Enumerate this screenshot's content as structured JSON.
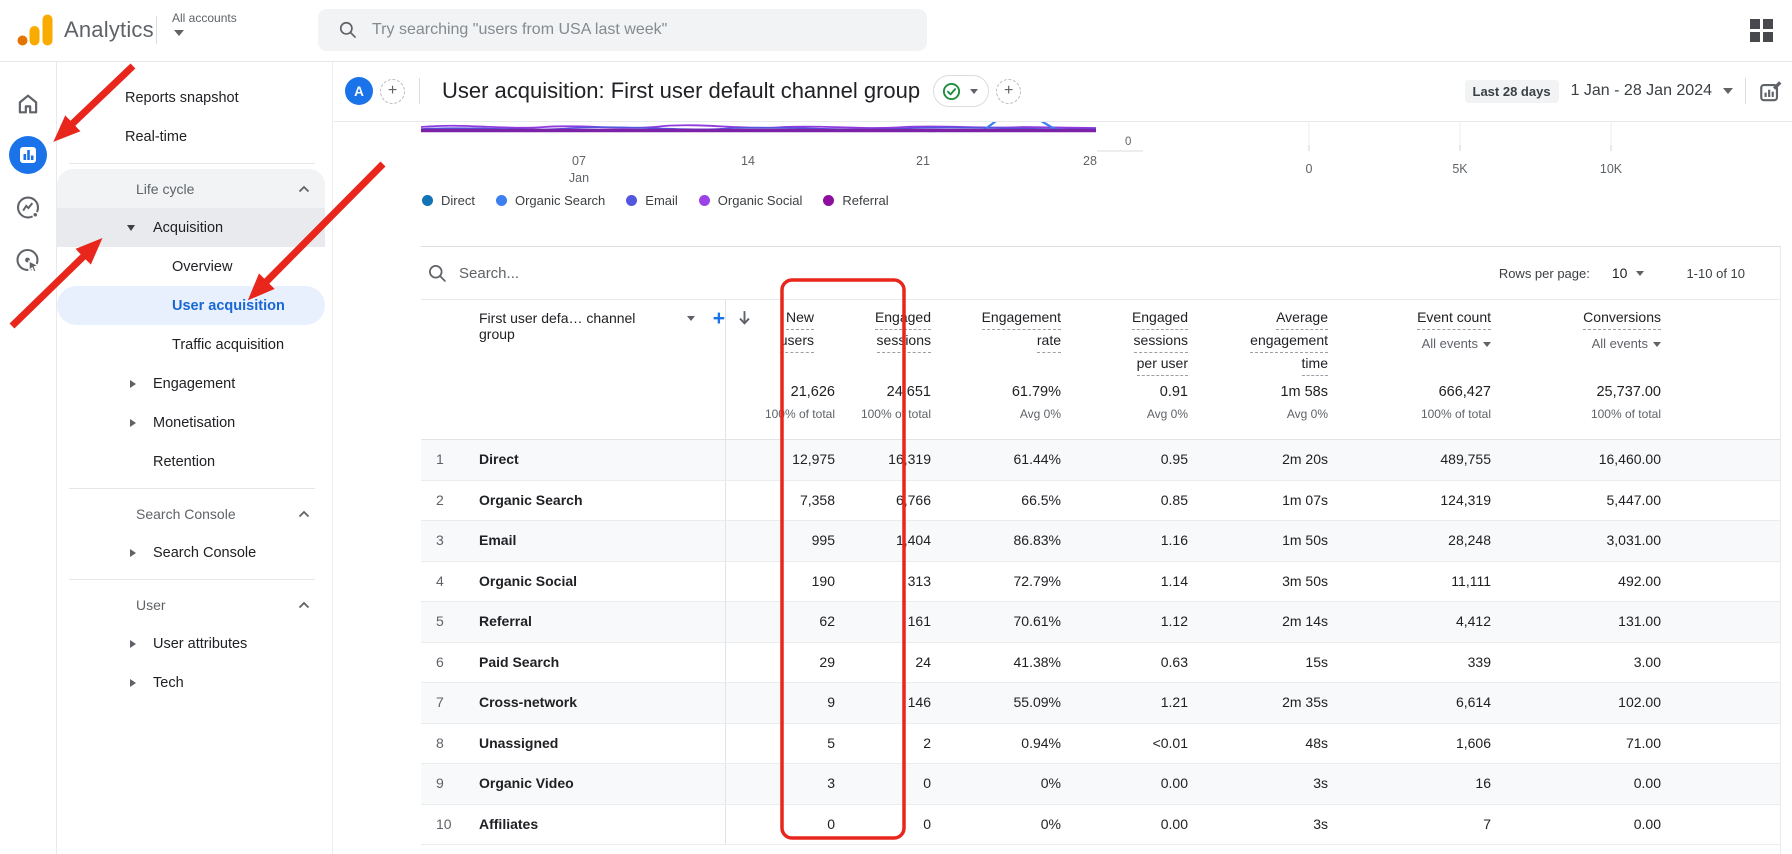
{
  "app": {
    "product_name": "Analytics",
    "account_selector": "All accounts",
    "search_placeholder": "Try searching \"users from USA last week\""
  },
  "report": {
    "avatar_letter": "A",
    "title": "User acquisition: First user default channel group",
    "date_preset": "Last 28 days",
    "date_range": "1 Jan - 28 Jan 2024"
  },
  "sidebar": {
    "items": [
      {
        "kind": "item",
        "label": "Reports snapshot",
        "indent": 0
      },
      {
        "kind": "item",
        "label": "Real-time",
        "indent": 0
      },
      {
        "kind": "divider"
      },
      {
        "kind": "header",
        "label": "Life cycle",
        "bg": "lifecycle"
      },
      {
        "kind": "item",
        "label": "Acquisition",
        "indent": 1,
        "arrow": "down",
        "bg": "acq"
      },
      {
        "kind": "item",
        "label": "Overview",
        "indent": 2
      },
      {
        "kind": "item",
        "label": "User acquisition",
        "indent": 2,
        "selected": true
      },
      {
        "kind": "item",
        "label": "Traffic acquisition",
        "indent": 2
      },
      {
        "kind": "item",
        "label": "Engagement",
        "indent": 1,
        "arrow": "right"
      },
      {
        "kind": "item",
        "label": "Monetisation",
        "indent": 1,
        "arrow": "right"
      },
      {
        "kind": "item",
        "label": "Retention",
        "indent": 1
      },
      {
        "kind": "divider"
      },
      {
        "kind": "header",
        "label": "Search Console"
      },
      {
        "kind": "item",
        "label": "Search Console",
        "indent": 1,
        "arrow": "right"
      },
      {
        "kind": "divider"
      },
      {
        "kind": "header",
        "label": "User"
      },
      {
        "kind": "item",
        "label": "User attributes",
        "indent": 1,
        "arrow": "right"
      },
      {
        "kind": "item",
        "label": "Tech",
        "indent": 1,
        "arrow": "right"
      }
    ]
  },
  "chart_data": [
    {
      "type": "line",
      "x_ticks": [
        "07 Jan",
        "14",
        "21",
        "28"
      ],
      "y_right_tick": "0",
      "legend": [
        {
          "label": "Direct",
          "color": "#1273b5"
        },
        {
          "label": "Organic Search",
          "color": "#3d7ff0"
        },
        {
          "label": "Email",
          "color": "#5357e0"
        },
        {
          "label": "Organic Social",
          "color": "#9b42e8"
        },
        {
          "label": "Referral",
          "color": "#8d0f9e"
        }
      ],
      "note_visible_region": "bottom edge of chart only"
    },
    {
      "type": "bar",
      "x_ticks": [
        "0",
        "5K",
        "10K"
      ]
    }
  ],
  "table": {
    "search_placeholder": "Search...",
    "rows_per_page_label": "Rows per page:",
    "rows_per_page_value": "10",
    "pagination_range": "1-10 of 10",
    "dimension_header": "First user defa… channel group",
    "columns": [
      {
        "lines": [
          "New",
          "users"
        ],
        "sortable_sorted": true
      },
      {
        "lines": [
          "Engaged",
          "sessions"
        ]
      },
      {
        "lines": [
          "Engagement",
          "rate"
        ]
      },
      {
        "lines": [
          "Engaged",
          "sessions",
          "per user"
        ]
      },
      {
        "lines": [
          "Average",
          "engagement",
          "time"
        ]
      },
      {
        "lines": [
          "Event count"
        ],
        "sub": "All events"
      },
      {
        "lines": [
          "Conversions"
        ],
        "sub": "All events"
      }
    ],
    "totals": [
      {
        "value": "21,626",
        "sub": "100% of total"
      },
      {
        "value": "24,651",
        "sub": "100% of total"
      },
      {
        "value": "61.79%",
        "sub": "Avg 0%"
      },
      {
        "value": "0.91",
        "sub": "Avg 0%"
      },
      {
        "value": "1m 58s",
        "sub": "Avg 0%"
      },
      {
        "value": "666,427",
        "sub": "100% of total"
      },
      {
        "value": "25,737.00",
        "sub": "100% of total"
      }
    ],
    "rows": [
      {
        "rank": "1",
        "channel": "Direct",
        "values": [
          "12,975",
          "16,319",
          "61.44%",
          "0.95",
          "2m 20s",
          "489,755",
          "16,460.00"
        ]
      },
      {
        "rank": "2",
        "channel": "Organic Search",
        "values": [
          "7,358",
          "6,766",
          "66.5%",
          "0.85",
          "1m 07s",
          "124,319",
          "5,447.00"
        ]
      },
      {
        "rank": "3",
        "channel": "Email",
        "values": [
          "995",
          "1,404",
          "86.83%",
          "1.16",
          "1m 50s",
          "28,248",
          "3,031.00"
        ]
      },
      {
        "rank": "4",
        "channel": "Organic Social",
        "values": [
          "190",
          "313",
          "72.79%",
          "1.14",
          "3m 50s",
          "11,111",
          "492.00"
        ]
      },
      {
        "rank": "5",
        "channel": "Referral",
        "values": [
          "62",
          "161",
          "70.61%",
          "1.12",
          "2m 14s",
          "4,412",
          "131.00"
        ]
      },
      {
        "rank": "6",
        "channel": "Paid Search",
        "values": [
          "29",
          "24",
          "41.38%",
          "0.63",
          "15s",
          "339",
          "3.00"
        ]
      },
      {
        "rank": "7",
        "channel": "Cross-network",
        "values": [
          "9",
          "146",
          "55.09%",
          "1.21",
          "2m 35s",
          "6,614",
          "102.00"
        ]
      },
      {
        "rank": "8",
        "channel": "Unassigned",
        "values": [
          "5",
          "2",
          "0.94%",
          "<0.01",
          "48s",
          "1,606",
          "71.00"
        ]
      },
      {
        "rank": "9",
        "channel": "Organic Video",
        "values": [
          "3",
          "0",
          "0%",
          "0.00",
          "3s",
          "16",
          "0.00"
        ]
      },
      {
        "rank": "10",
        "channel": "Affiliates",
        "values": [
          "0",
          "0",
          "0%",
          "0.00",
          "3s",
          "7",
          "0.00"
        ]
      }
    ]
  },
  "annotations": {
    "color": "#e8261c",
    "highlighted_column": "New users",
    "arrow_targets": [
      "reports-nav-icon",
      "sidebar-item-acquisition",
      "sidebar-item-user-acquisition"
    ]
  },
  "colors": {
    "accent_blue": "#1a73e8",
    "selected_nav_bg": "#e8f0fe",
    "annotation_red": "#e8261c"
  }
}
